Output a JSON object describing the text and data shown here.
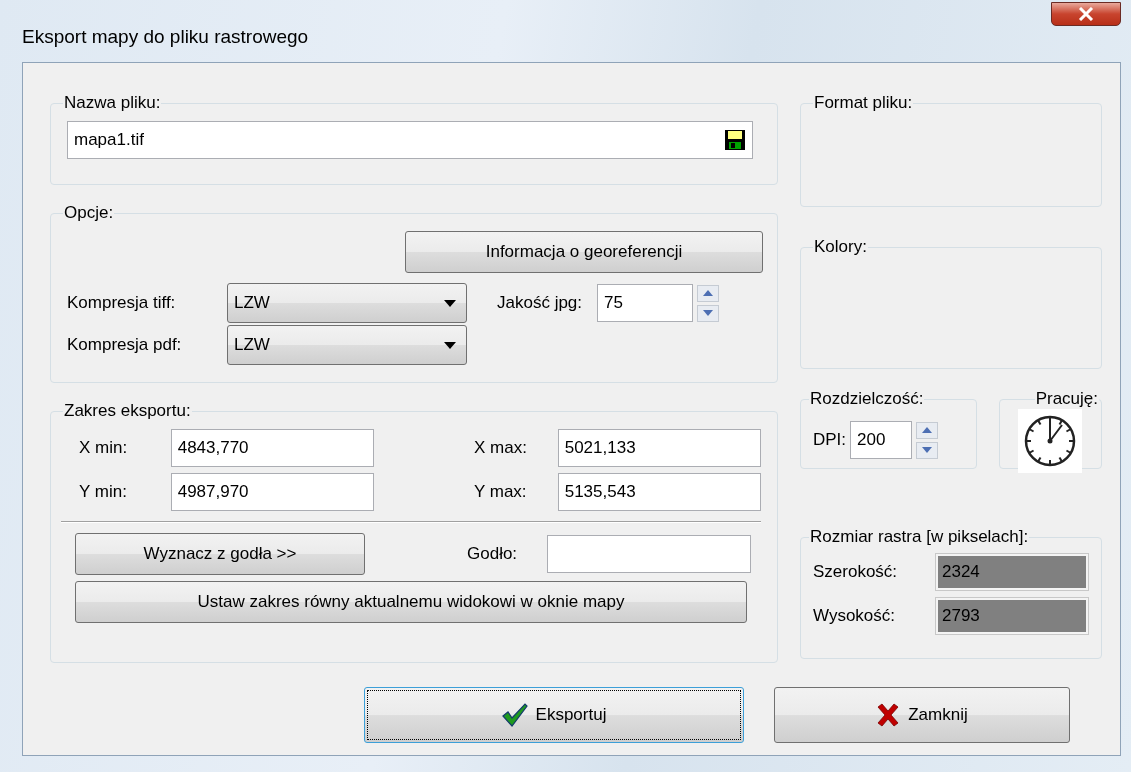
{
  "window": {
    "title": "Eksport mapy do pliku rastrowego"
  },
  "file": {
    "legend": "Nazwa pliku:",
    "value": "mapa1.tif"
  },
  "options": {
    "legend": "Opcje:",
    "georef_button": "Informacja o georeferencji",
    "tiff_label": "Kompresja tiff:",
    "tiff_value": "LZW",
    "jpg_label": "Jakość jpg:",
    "jpg_value": "75",
    "pdf_label": "Kompresja pdf:",
    "pdf_value": "LZW"
  },
  "extent": {
    "legend": "Zakres eksportu:",
    "fields": [
      {
        "label": "X min:",
        "value": "4843,770"
      },
      {
        "label": "X max:",
        "value": "5021,133"
      },
      {
        "label": "Y min:",
        "value": "4987,970"
      },
      {
        "label": "Y max:",
        "value": "5135,543"
      }
    ],
    "from_grid_button": "Wyznacz z godła >>",
    "grid_label": "Godło:",
    "set_view_button": "Ustaw zakres równy aktualnemu widokowi w oknie mapy"
  },
  "format": {
    "legend": "Format pliku:"
  },
  "colors": {
    "legend": "Kolory:"
  },
  "resolution": {
    "legend": "Rozdzielczość:",
    "dpi_label": "DPI:",
    "dpi_value": "200"
  },
  "working": {
    "legend": "Pracuję:"
  },
  "raster_size": {
    "legend": "Rozmiar rastra [w pikselach]:",
    "width_label": "Szerokość:",
    "width_value": "2324",
    "height_label": "Wysokość:",
    "height_value": "2793"
  },
  "buttons": [
    {
      "label": "Eksportuj",
      "kind": "export",
      "focused": true
    },
    {
      "label": "Zamknij",
      "kind": "close",
      "focused": false
    }
  ]
}
